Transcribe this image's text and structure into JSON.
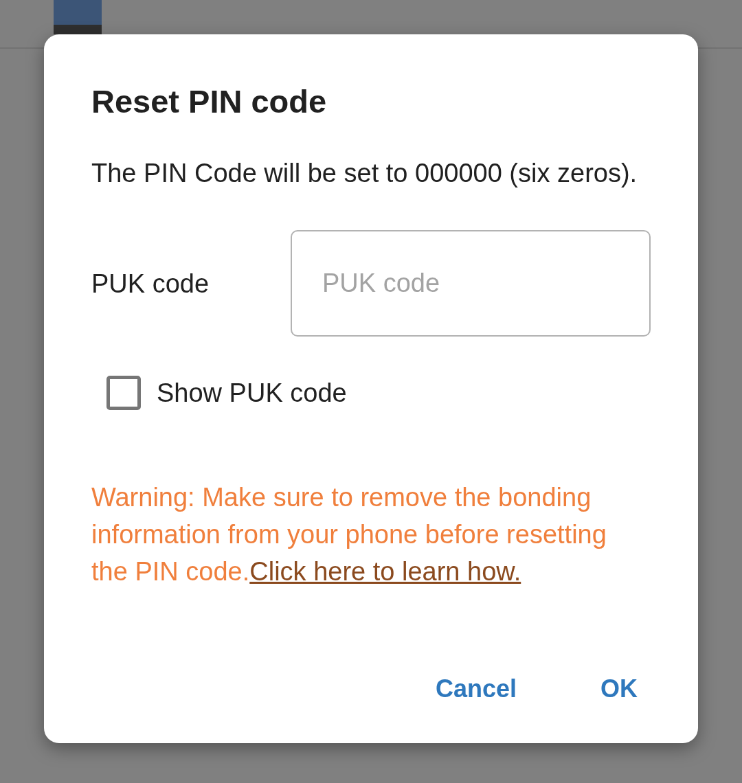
{
  "dialog": {
    "title": "Reset PIN code",
    "message": "The PIN Code will be set to 000000 (six zeros).",
    "puk_field": {
      "label": "PUK code",
      "placeholder": "PUK code"
    },
    "show_puk": {
      "label": "Show PUK code",
      "checked": false
    },
    "warning": {
      "text": "Warning: Make sure to remove the bonding information from your phone before resetting the PIN code.",
      "link": "Click here to learn how."
    },
    "buttons": [
      {
        "label": "Cancel"
      },
      {
        "label": "OK"
      }
    ]
  }
}
